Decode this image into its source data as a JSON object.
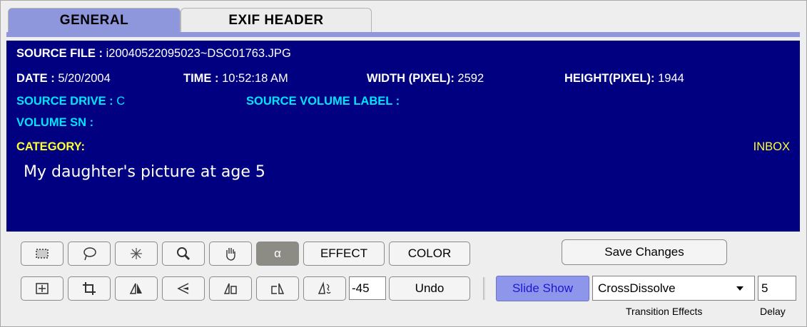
{
  "tabs": [
    {
      "label": "GENERAL",
      "active": true
    },
    {
      "label": "EXIF HEADER",
      "active": false
    }
  ],
  "info": {
    "source_file_label": "SOURCE FILE :",
    "source_file_value": "i20040522095023~DSC01763.JPG",
    "date_label": "DATE :",
    "date_value": "5/20/2004",
    "time_label": "TIME :",
    "time_value": "10:52:18 AM",
    "width_label": "WIDTH (PIXEL):",
    "width_value": "2592",
    "height_label": "HEIGHT(PIXEL):",
    "height_value": "1944",
    "source_drive_label": "SOURCE DRIVE :",
    "source_drive_value": "C",
    "source_volume_label_label": "SOURCE VOLUME LABEL :",
    "source_volume_label_value": "",
    "volume_sn_label": "VOLUME SN :",
    "volume_sn_value": "",
    "category_label": "CATEGORY:",
    "category_value": "INBOX",
    "description": "My daughter's picture at age 5"
  },
  "toolbar": {
    "row1_icons": [
      "select-rect-icon",
      "lasso-icon",
      "magic-wand-icon",
      "zoom-icon",
      "hand-icon",
      "alpha-icon"
    ],
    "alpha_glyph": "α",
    "effect_label": "EFFECT",
    "color_label": "COLOR",
    "row2_icons": [
      "fit-icon",
      "crop-icon",
      "flip-horizontal-icon",
      "flip-vertical-icon",
      "rotate-left-icon",
      "rotate-right-icon",
      "rotate-angle-icon"
    ],
    "angle_value": "-45",
    "undo_label": "Undo",
    "save_label": "Save Changes"
  },
  "slideshow": {
    "button_label": "Slide Show",
    "transition_value": "CrossDissolve",
    "delay_value": "5",
    "transition_caption": "Transition Effects",
    "delay_caption": "Delay"
  },
  "colors": {
    "panel_bg": "#000080",
    "tab_active": "#8e96dc",
    "label_cyan": "#00e5ff",
    "label_yellow": "#ffff33",
    "slideshow_bg": "#8e96ec"
  }
}
